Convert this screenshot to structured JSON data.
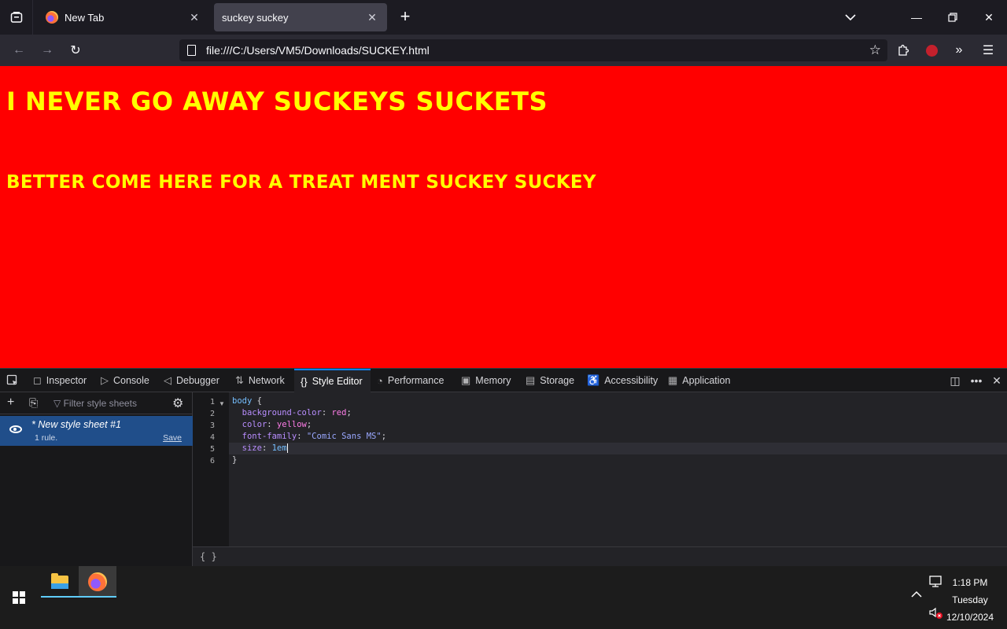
{
  "browser": {
    "tabs": [
      {
        "title": "New Tab",
        "active": false
      },
      {
        "title": "suckey suckey",
        "active": true
      }
    ],
    "url": "file:///C:/Users/VM5/Downloads/SUCKEY.html"
  },
  "page": {
    "heading": "I NEVER GO AWAY SUCKEYS SUCKETS",
    "subheading": "BETTER COME HERE FOR A TREAT MENT SUCKEY SUCKEY",
    "colors": {
      "background": "#ff0000",
      "text": "#ffff00"
    }
  },
  "devtools": {
    "tabs": [
      "Inspector",
      "Console",
      "Debugger",
      "Network",
      "Style Editor",
      "Performance",
      "Memory",
      "Storage",
      "Accessibility",
      "Application"
    ],
    "active_tab": "Style Editor",
    "filter_placeholder": "Filter style sheets",
    "stylesheet": {
      "name": "* New style sheet #1",
      "rules": "1 rule.",
      "save": "Save"
    },
    "line_numbers": [
      "1",
      "2",
      "3",
      "4",
      "5",
      "6"
    ],
    "code": {
      "l1_selector": "body",
      "l1_brace": " {",
      "l2_prop": "background-color",
      "l2_val": "red",
      "l3_prop": "color",
      "l3_val": "yellow",
      "l4_prop": "font-family",
      "l4_val": "\"Comic Sans MS\"",
      "l5_prop": "size",
      "l5_val": "1em",
      "l6": "}"
    },
    "footer": "{ }"
  },
  "taskbar": {
    "time": "1:18 PM",
    "day": "Tuesday",
    "date": "12/10/2024"
  }
}
